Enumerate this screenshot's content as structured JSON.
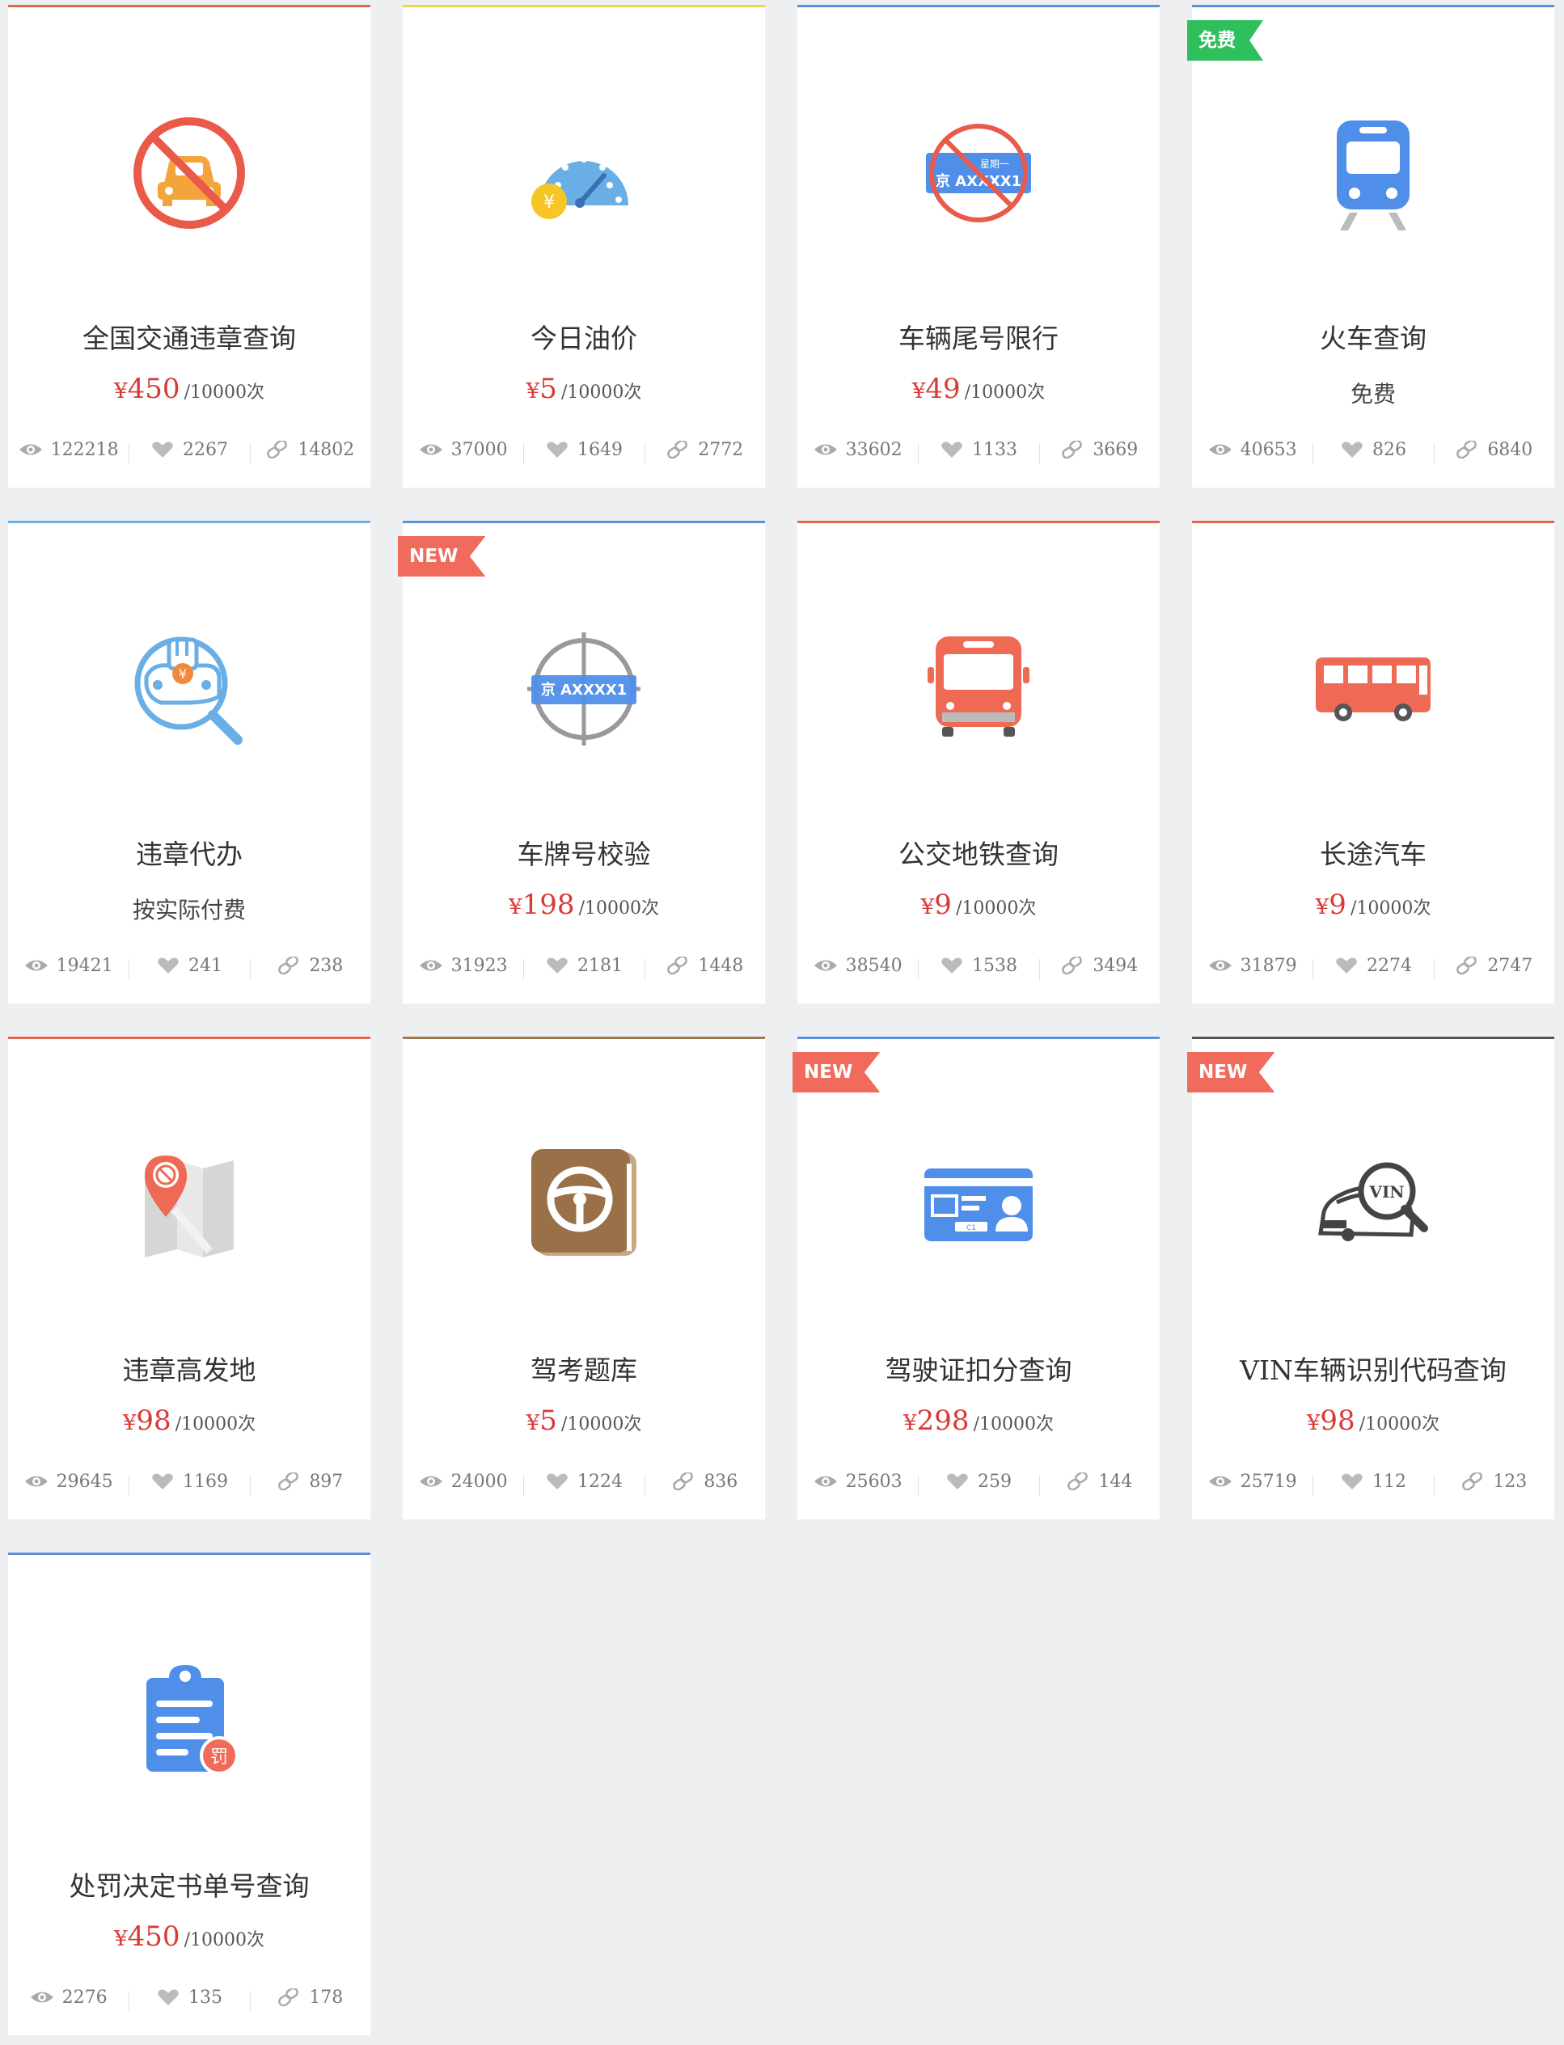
{
  "cards": [
    {
      "name": "全国交通违章查询",
      "price": {
        "currency": "¥",
        "amount": "450",
        "unit": "/10000次"
      },
      "views": "122218",
      "likes": "2267",
      "links": "14802",
      "icon": "no-car-icon",
      "accent": "#e0664f",
      "badge": null
    },
    {
      "name": "今日油价",
      "price": {
        "currency": "¥",
        "amount": "5",
        "unit": "/10000次"
      },
      "views": "37000",
      "likes": "1649",
      "links": "2772",
      "icon": "fuel-gauge-icon",
      "accent": "#f5d04a",
      "badge": null
    },
    {
      "name": "车辆尾号限行",
      "price": {
        "currency": "¥",
        "amount": "49",
        "unit": "/10000次"
      },
      "views": "33602",
      "likes": "1133",
      "links": "3669",
      "icon": "plate-restriction-icon",
      "accent": "#5b8fdc",
      "badge": null,
      "plate": {
        "line1": "星期一",
        "line2": "京 AXXXX1"
      }
    },
    {
      "name": "火车查询",
      "note": "免费",
      "views": "40653",
      "likes": "826",
      "links": "6840",
      "icon": "train-icon",
      "accent": "#5b8fdc",
      "badge": {
        "text": "免费",
        "color": "#2fbf5d"
      }
    },
    {
      "name": "违章代办",
      "note": "按实际付费",
      "views": "19421",
      "likes": "241",
      "links": "238",
      "icon": "violation-agent-icon",
      "accent": "#6aaee6",
      "badge": null
    },
    {
      "name": "车牌号校验",
      "price": {
        "currency": "¥",
        "amount": "198",
        "unit": "/10000次"
      },
      "views": "31923",
      "likes": "2181",
      "links": "1448",
      "icon": "plate-target-icon",
      "accent": "#5b8fdc",
      "badge": {
        "text": "NEW",
        "color": "#f06b5c"
      },
      "plate": {
        "line2": "京 AXXXX1"
      }
    },
    {
      "name": "公交地铁查询",
      "price": {
        "currency": "¥",
        "amount": "9",
        "unit": "/10000次"
      },
      "views": "38540",
      "likes": "1538",
      "links": "3494",
      "icon": "bus-front-icon",
      "accent": "#e0664f",
      "badge": null
    },
    {
      "name": "长途汽车",
      "price": {
        "currency": "¥",
        "amount": "9",
        "unit": "/10000次"
      },
      "views": "31879",
      "likes": "2274",
      "links": "2747",
      "icon": "coach-bus-icon",
      "accent": "#e0664f",
      "badge": null
    },
    {
      "name": "违章高发地",
      "price": {
        "currency": "¥",
        "amount": "98",
        "unit": "/10000次"
      },
      "views": "29645",
      "likes": "1169",
      "links": "897",
      "icon": "map-pin-icon",
      "accent": "#e0664f",
      "badge": null
    },
    {
      "name": "驾考题库",
      "price": {
        "currency": "¥",
        "amount": "5",
        "unit": "/10000次"
      },
      "views": "24000",
      "likes": "1224",
      "links": "836",
      "icon": "steering-book-icon",
      "accent": "#a07850",
      "badge": null
    },
    {
      "name": "驾驶证扣分查询",
      "price": {
        "currency": "¥",
        "amount": "298",
        "unit": "/10000次"
      },
      "views": "25603",
      "likes": "259",
      "links": "144",
      "icon": "license-card-icon",
      "accent": "#5b8fdc",
      "badge": {
        "text": "NEW",
        "color": "#f06b5c"
      }
    },
    {
      "name": "VIN车辆识别代码查询",
      "price": {
        "currency": "¥",
        "amount": "98",
        "unit": "/10000次"
      },
      "views": "25719",
      "likes": "112",
      "links": "123",
      "icon": "vin-search-icon",
      "accent": "#555555",
      "badge": {
        "text": "NEW",
        "color": "#f06b5c"
      }
    },
    {
      "name": "处罚决定书单号查询",
      "price": {
        "currency": "¥",
        "amount": "450",
        "unit": "/10000次"
      },
      "views": "2276",
      "likes": "135",
      "links": "178",
      "icon": "penalty-clipboard-icon",
      "accent": "#5b8fdc",
      "badge": null
    }
  ],
  "icon_labels": {
    "yen": "¥",
    "penalty": "罚",
    "vin": "VIN",
    "license_class": "C1"
  }
}
